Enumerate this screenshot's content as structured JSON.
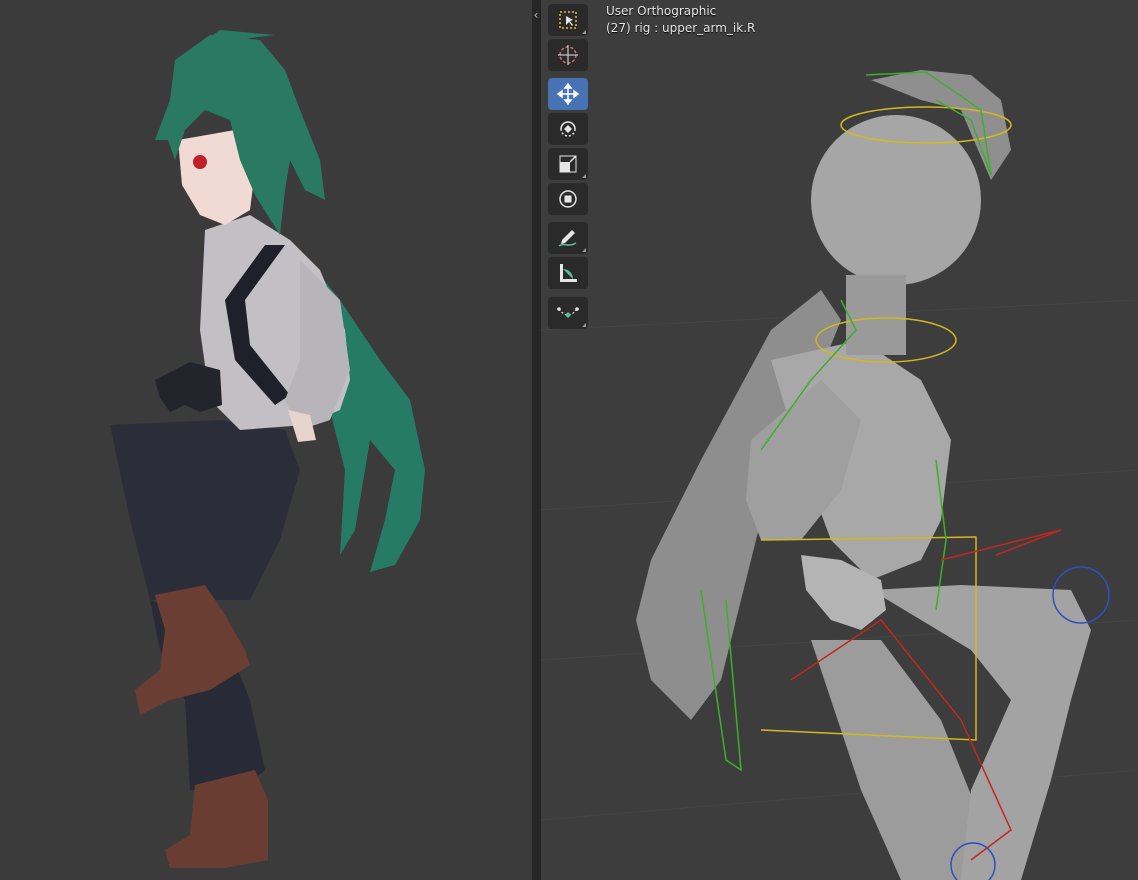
{
  "viewport_left": {
    "content": "character-render"
  },
  "splitter": {
    "collapse_glyph": "‹"
  },
  "viewport_right": {
    "view_mode": "User Orthographic",
    "active_object": "(27) rig : upper_arm_ik.R"
  },
  "toolbar": {
    "tools": [
      {
        "icon": "select-box-icon",
        "active": false
      },
      {
        "icon": "cursor-icon",
        "active": false
      },
      {
        "icon": "move-icon",
        "active": true
      },
      {
        "icon": "rotate-icon",
        "active": false
      },
      {
        "icon": "scale-icon",
        "active": false
      },
      {
        "icon": "transform-icon",
        "active": false
      },
      {
        "icon": "annotate-icon",
        "active": false
      },
      {
        "icon": "measure-icon",
        "active": false
      },
      {
        "icon": "bone-envelope-icon",
        "active": false
      }
    ]
  },
  "colors": {
    "active_tool": "#4772b3",
    "hair": "#2a7a62",
    "shirt": "#c2c0c4",
    "pants": "#2b2e38",
    "boots": "#6b3e34",
    "gray_mesh": "#9a9a9a"
  }
}
